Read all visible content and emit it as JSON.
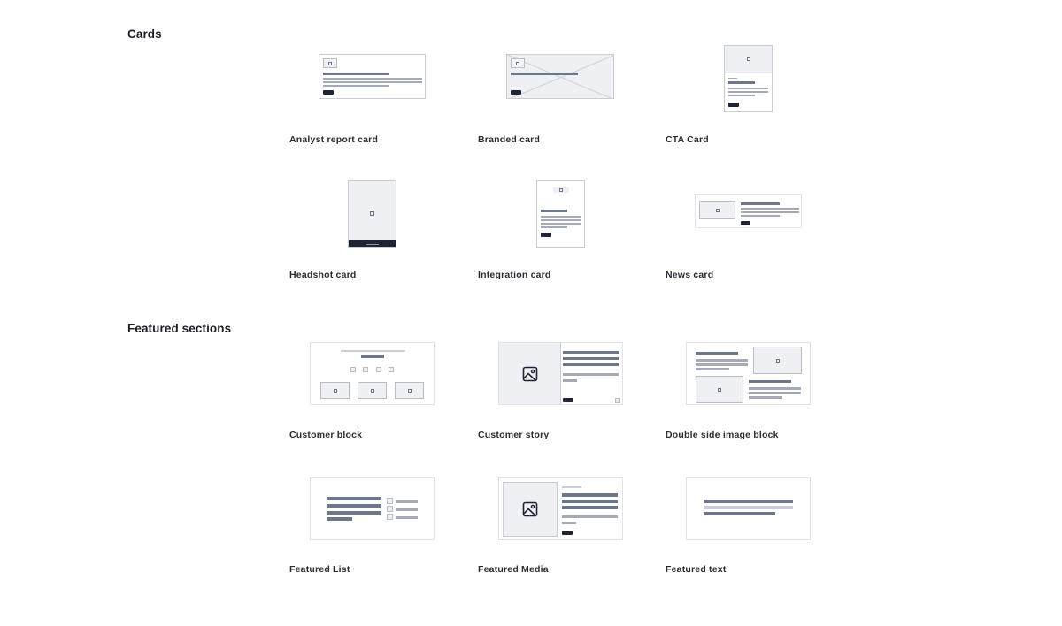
{
  "sections": [
    {
      "title": "Cards",
      "items": [
        {
          "label": "Analyst report card",
          "thumbnail": "analyst-report-card-preview"
        },
        {
          "label": "Branded card",
          "thumbnail": "branded-card-preview"
        },
        {
          "label": "CTA Card",
          "thumbnail": "cta-card-preview"
        },
        {
          "label": "Headshot card",
          "thumbnail": "headshot-card-preview"
        },
        {
          "label": "Integration card",
          "thumbnail": "integration-card-preview"
        },
        {
          "label": "News card",
          "thumbnail": "news-card-preview"
        }
      ]
    },
    {
      "title": "Featured sections",
      "items": [
        {
          "label": "Customer block",
          "thumbnail": "customer-block-preview"
        },
        {
          "label": "Customer story",
          "thumbnail": "customer-story-preview"
        },
        {
          "label": "Double side image block",
          "thumbnail": "double-side-image-block-preview"
        },
        {
          "label": "Featured List",
          "thumbnail": "featured-list-preview"
        },
        {
          "label": "Featured Media",
          "thumbnail": "featured-media-preview"
        },
        {
          "label": "Featured text",
          "thumbnail": "featured-text-preview"
        }
      ]
    }
  ],
  "colors": {
    "background": "#ffffff",
    "text": "#1c1f26",
    "placeholder_fill": "#eef0f4",
    "bar_dark": "#6e768a",
    "bar_light": "#a4aab8",
    "button": "#1e2433"
  }
}
